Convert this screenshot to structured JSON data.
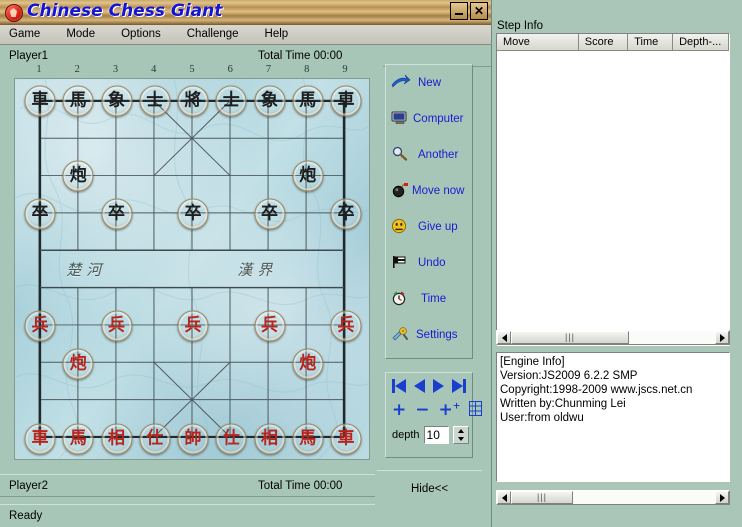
{
  "window": {
    "title": "Chinese Chess Giant",
    "app_icon": "chess-app-icon",
    "minimize_label": "minimize",
    "close_label": "✕"
  },
  "menu": {
    "items": [
      {
        "label": "Game"
      },
      {
        "label": "Mode"
      },
      {
        "label": "Options"
      },
      {
        "label": "Challenge"
      },
      {
        "label": "Help"
      }
    ]
  },
  "players": {
    "top": {
      "name": "Player1",
      "time_label": "Total Time 00:00"
    },
    "bottom": {
      "name": "Player2",
      "time_label": "Total Time 00:00"
    }
  },
  "board": {
    "column_numbers": [
      "1",
      "2",
      "3",
      "4",
      "5",
      "6",
      "7",
      "8",
      "9"
    ],
    "river_left": "楚河",
    "river_right": "漢界",
    "pieces": [
      {
        "text": "車",
        "color": "black",
        "col": 0,
        "row": 0
      },
      {
        "text": "馬",
        "color": "black",
        "col": 1,
        "row": 0
      },
      {
        "text": "象",
        "color": "black",
        "col": 2,
        "row": 0
      },
      {
        "text": "士",
        "color": "black",
        "col": 3,
        "row": 0
      },
      {
        "text": "將",
        "color": "black",
        "col": 4,
        "row": 0
      },
      {
        "text": "士",
        "color": "black",
        "col": 5,
        "row": 0
      },
      {
        "text": "象",
        "color": "black",
        "col": 6,
        "row": 0
      },
      {
        "text": "馬",
        "color": "black",
        "col": 7,
        "row": 0
      },
      {
        "text": "車",
        "color": "black",
        "col": 8,
        "row": 0
      },
      {
        "text": "炮",
        "color": "black",
        "col": 1,
        "row": 2
      },
      {
        "text": "炮",
        "color": "black",
        "col": 7,
        "row": 2
      },
      {
        "text": "卒",
        "color": "black",
        "col": 0,
        "row": 3
      },
      {
        "text": "卒",
        "color": "black",
        "col": 2,
        "row": 3
      },
      {
        "text": "卒",
        "color": "black",
        "col": 4,
        "row": 3
      },
      {
        "text": "卒",
        "color": "black",
        "col": 6,
        "row": 3
      },
      {
        "text": "卒",
        "color": "black",
        "col": 8,
        "row": 3
      },
      {
        "text": "兵",
        "color": "red",
        "col": 0,
        "row": 6
      },
      {
        "text": "兵",
        "color": "red",
        "col": 2,
        "row": 6
      },
      {
        "text": "兵",
        "color": "red",
        "col": 4,
        "row": 6
      },
      {
        "text": "兵",
        "color": "red",
        "col": 6,
        "row": 6
      },
      {
        "text": "兵",
        "color": "red",
        "col": 8,
        "row": 6
      },
      {
        "text": "炮",
        "color": "red",
        "col": 1,
        "row": 7
      },
      {
        "text": "炮",
        "color": "red",
        "col": 7,
        "row": 7
      },
      {
        "text": "車",
        "color": "red",
        "col": 0,
        "row": 9
      },
      {
        "text": "馬",
        "color": "red",
        "col": 1,
        "row": 9
      },
      {
        "text": "相",
        "color": "red",
        "col": 2,
        "row": 9
      },
      {
        "text": "仕",
        "color": "red",
        "col": 3,
        "row": 9
      },
      {
        "text": "帥",
        "color": "red",
        "col": 4,
        "row": 9
      },
      {
        "text": "仕",
        "color": "red",
        "col": 5,
        "row": 9
      },
      {
        "text": "相",
        "color": "red",
        "col": 6,
        "row": 9
      },
      {
        "text": "馬",
        "color": "red",
        "col": 7,
        "row": 9
      },
      {
        "text": "車",
        "color": "red",
        "col": 8,
        "row": 9
      }
    ]
  },
  "actions": {
    "buttons": [
      {
        "label": "New",
        "icon": "arrow-right-icon"
      },
      {
        "label": "Computer",
        "icon": "monitor-icon"
      },
      {
        "label": "Another",
        "icon": "magnifier-icon"
      },
      {
        "label": "Move now",
        "icon": "bomb-icon"
      },
      {
        "label": "Give up",
        "icon": "sad-face-icon"
      },
      {
        "label": "Undo",
        "icon": "flag-icon"
      },
      {
        "label": "Time",
        "icon": "clock-icon"
      },
      {
        "label": "Settings",
        "icon": "tools-icon"
      }
    ]
  },
  "nav": {
    "first_label": "first-move",
    "prev_label": "previous-move",
    "next_label": "next-move",
    "last_label": "last-move",
    "plus_label": "+",
    "minus_label": "−",
    "add_label": "+",
    "list_label": "list",
    "depth_label": "depth",
    "depth_value": "10"
  },
  "hide_button": {
    "label": "Hide<<"
  },
  "status": {
    "text": "Ready"
  },
  "side": {
    "title": "Step Info",
    "columns": [
      {
        "label": "Move",
        "width": 88
      },
      {
        "label": "Score",
        "width": 53
      },
      {
        "label": "Time",
        "width": 48
      },
      {
        "label": "Depth-...",
        "width": 60
      }
    ],
    "engine_info": [
      "[Engine Info]",
      "Version:JS2009 6.2.2 SMP",
      "Copyright:1998-2009 www.jscs.net.cn",
      "Written by:Chunming Lei",
      "User:from oldwu"
    ]
  },
  "colors": {
    "window_bg": "#a8c6b8",
    "title_blue": "#1414d2",
    "button_blue": "#1a1ad0",
    "red_piece": "#b8251c",
    "black_piece": "#1d1d1d"
  }
}
